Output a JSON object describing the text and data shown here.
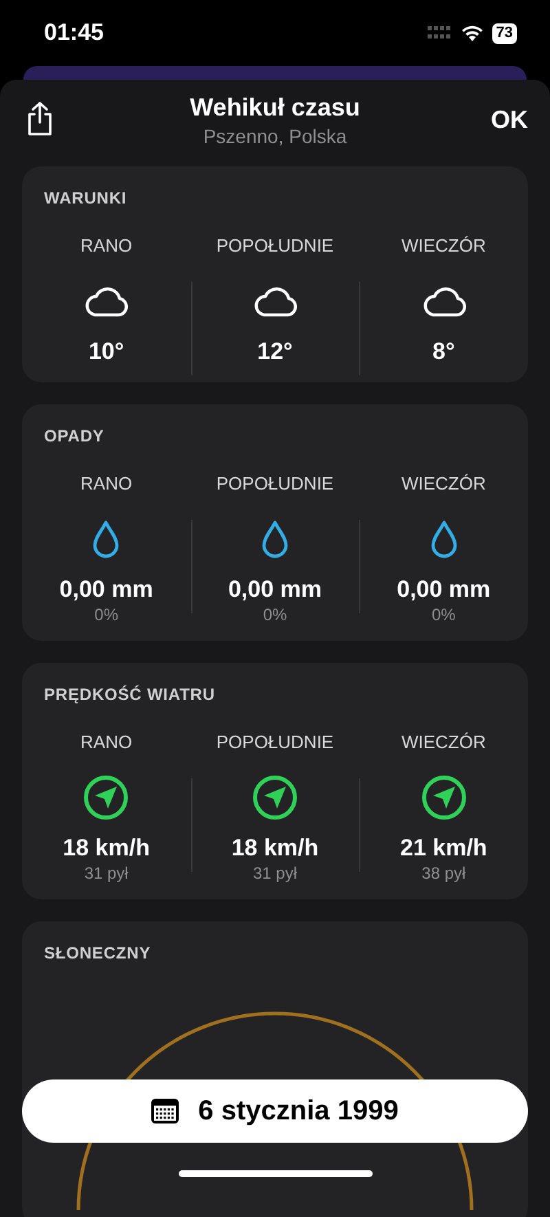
{
  "status_bar": {
    "time": "01:45",
    "battery": "73"
  },
  "header": {
    "title": "Wehikuł czasu",
    "subtitle": "Pszenno, Polska",
    "done": "OK"
  },
  "sections": [
    {
      "kind": "temperature",
      "title": "WARUNKI",
      "periods": [
        {
          "label": "RANO",
          "value": "10°"
        },
        {
          "label": "POPOŁUDNIE",
          "value": "12°"
        },
        {
          "label": "WIECZÓR",
          "value": "8°"
        }
      ]
    },
    {
      "kind": "precipitation",
      "title": "OPADY",
      "periods": [
        {
          "label": "RANO",
          "value": "0,00 mm",
          "sub": "0%"
        },
        {
          "label": "POPOŁUDNIE",
          "value": "0,00 mm",
          "sub": "0%"
        },
        {
          "label": "WIECZÓR",
          "value": "0,00 mm",
          "sub": "0%"
        }
      ]
    },
    {
      "kind": "wind",
      "title": "PRĘDKOŚĆ WIATRU",
      "periods": [
        {
          "label": "RANO",
          "value": "18 km/h",
          "sub": "31 pył"
        },
        {
          "label": "POPOŁUDNIE",
          "value": "18 km/h",
          "sub": "31 pył"
        },
        {
          "label": "WIECZÓR",
          "value": "21 km/h",
          "sub": "38 pył"
        }
      ]
    },
    {
      "kind": "sun",
      "title": "SŁONECZNY"
    }
  ],
  "date_button": {
    "label": "6 stycznia 1999"
  }
}
